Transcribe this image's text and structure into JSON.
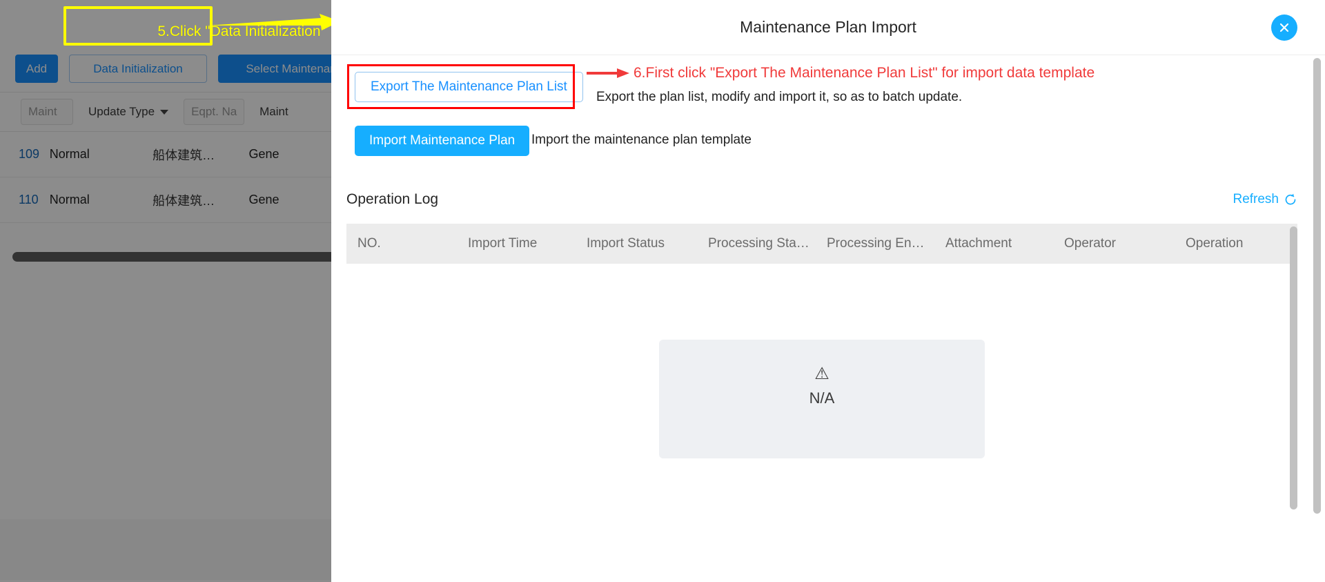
{
  "background": {
    "annotation_step5": "5.Click \"Data Initialization\"",
    "toolbar": {
      "add_label": "Add",
      "data_initialization_label": "Data Initialization",
      "select_maintenance_label": "Select Maintenance"
    },
    "filters": {
      "maint_placeholder": "Maint",
      "update_type_label": "Update Type",
      "eqpt_name_placeholder": "Eqpt. Na",
      "maint_label": "Maint"
    },
    "rows": [
      {
        "no": "109",
        "update_type": "Normal",
        "eqpt": "船体建筑…",
        "maint": "Gene"
      },
      {
        "no": "110",
        "update_type": "Normal",
        "eqpt": "船体建筑…",
        "maint": "Gene"
      }
    ]
  },
  "modal": {
    "title": "Maintenance Plan Import",
    "close_icon": "close-icon",
    "export": {
      "button_label": "Export The Maintenance Plan List",
      "description": "Export the plan list, modify and import it, so as to batch update.",
      "annotation_step6": "6.First click \"Export The Maintenance Plan List\" for import data template"
    },
    "import": {
      "button_label": "Import Maintenance Plan",
      "description": "Import the maintenance plan template"
    },
    "operation_log": {
      "title": "Operation Log",
      "refresh_label": "Refresh",
      "refresh_icon": "refresh-icon",
      "columns": [
        "NO.",
        "Import Time",
        "Import Status",
        "Processing Sta…",
        "Processing En…",
        "Attachment",
        "Operator",
        "Operation"
      ],
      "rows": [],
      "empty_icon": "warning-triangle-icon",
      "empty_text": "N/A"
    }
  },
  "colors": {
    "accent_blue": "#16aeff",
    "link_blue": "#1890ff",
    "annotation_yellow": "#ffff00",
    "annotation_red": "#f03a3a",
    "highlight_red_box": "#ff0000"
  }
}
